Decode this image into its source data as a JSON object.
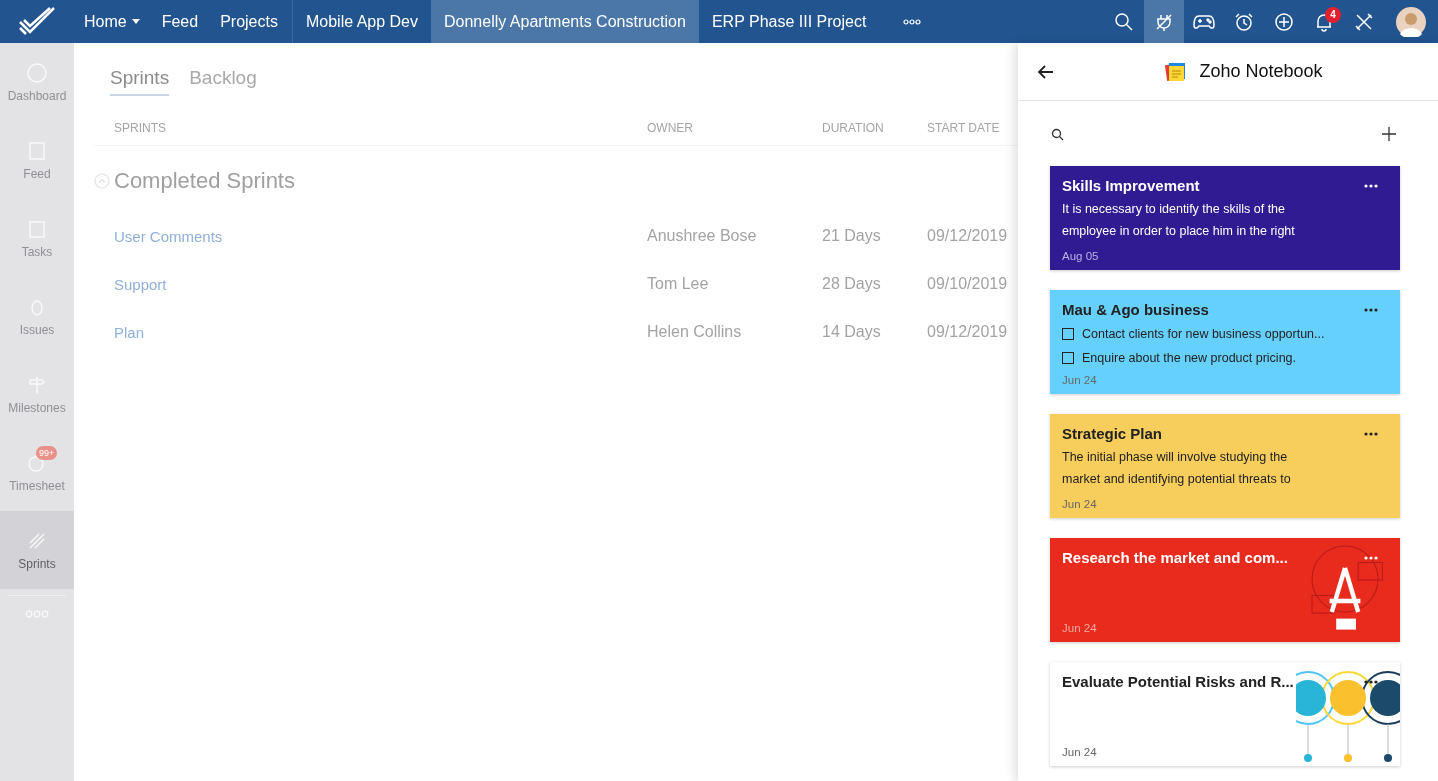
{
  "nav": {
    "links": [
      {
        "label": "Home",
        "has_menu": true
      },
      {
        "label": "Feed",
        "has_menu": false
      },
      {
        "label": "Projects",
        "has_menu": false
      }
    ],
    "project_tabs": [
      {
        "label": "Mobile App Dev",
        "selected": false
      },
      {
        "label": "Donnelly Apartments Construction",
        "selected": true
      },
      {
        "label": "ERP Phase III Project",
        "selected": false
      }
    ],
    "toolbar": [
      {
        "selected": false
      },
      {
        "selected": true
      },
      {
        "selected": false
      },
      {
        "selected": false
      },
      {
        "selected": false
      },
      {
        "selected": false,
        "badge": "4"
      },
      {
        "selected": false
      }
    ]
  },
  "sidebar": {
    "items": [
      {
        "label": "Dashboard",
        "selected": false
      },
      {
        "label": "Feed",
        "selected": false
      },
      {
        "label": "Tasks",
        "selected": false
      },
      {
        "label": "Issues",
        "selected": false
      },
      {
        "label": "Milestones",
        "selected": false
      },
      {
        "label": "Timesheet",
        "selected": false,
        "badge": "99+"
      },
      {
        "label": "Sprints",
        "selected": true
      }
    ]
  },
  "main": {
    "tabs": [
      {
        "label": "Sprints",
        "selected": true
      },
      {
        "label": "Backlog",
        "selected": false
      }
    ],
    "columns": [
      "SPRINTS",
      "OWNER",
      "DURATION",
      "START DATE"
    ],
    "group": {
      "title": "Completed Sprints",
      "expanded": true
    },
    "rows": [
      {
        "name": "User Comments",
        "owner": "Anushree Bose",
        "duration": "21 Days",
        "start_date": "09/12/2019"
      },
      {
        "name": "Support",
        "owner": "Tom Lee",
        "duration": "28 Days",
        "start_date": "09/10/2019"
      },
      {
        "name": "Plan",
        "owner": "Helen Collins",
        "duration": "14 Days",
        "start_date": "09/12/2019"
      }
    ]
  },
  "panel": {
    "title": "Zoho Notebook",
    "notes": [
      {
        "kind": "text",
        "title": "Skills Improvement",
        "lines": [
          "It is necessary to identify the skills of the",
          "employee in order to place him in the right"
        ],
        "date": "Aug 05",
        "color": "#311b92"
      },
      {
        "kind": "checklist",
        "title": "Mau & Ago business",
        "items": [
          {
            "text": "Contact clients for new business opportun...",
            "checked": false
          },
          {
            "text": "Enquire about the new product pricing.",
            "checked": false
          }
        ],
        "date": "Jun 24",
        "color": "#66d0fc"
      },
      {
        "kind": "text",
        "title": "Strategic Plan",
        "lines": [
          "The initial phase will involve studying the",
          "market and identifying potential threats to"
        ],
        "date": "Jun 24",
        "color": "#f7cd5c"
      },
      {
        "kind": "file",
        "title": "Research the market and com...",
        "date": "Jun 24",
        "color": "#e82b1c"
      },
      {
        "title": "Evaluate Potential Risks and R...",
        "date": "Jun 24",
        "color": "#ffffff"
      }
    ]
  }
}
